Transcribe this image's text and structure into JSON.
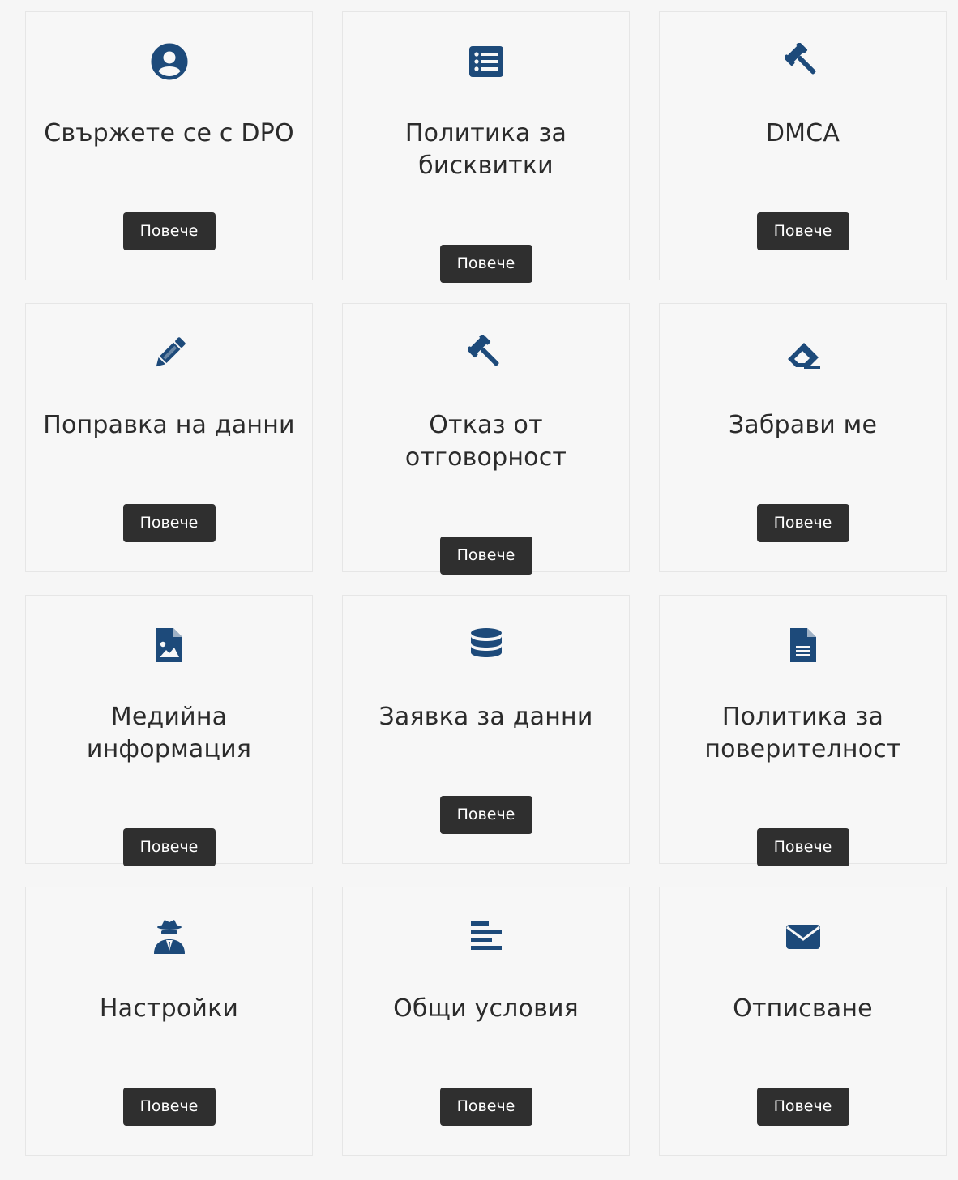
{
  "accent_color": "#1d4a7a",
  "button_color": "#2f2f2f",
  "cards": [
    {
      "title": "Свържете се с DPO",
      "button": "Повече",
      "icon": "user-circle-icon"
    },
    {
      "title": "Политика за бисквитки",
      "button": "Повече",
      "icon": "list-alt-icon"
    },
    {
      "title": "DMCA",
      "button": "Повече",
      "icon": "gavel-icon"
    },
    {
      "title": "Поправка на данни",
      "button": "Повече",
      "icon": "pencil-icon"
    },
    {
      "title": "Отказ от отговорност",
      "button": "Повече",
      "icon": "gavel-icon"
    },
    {
      "title": "Забрави ме",
      "button": "Повече",
      "icon": "eraser-icon"
    },
    {
      "title": "Медийна информация",
      "button": "Повече",
      "icon": "file-image-icon"
    },
    {
      "title": "Заявка за данни",
      "button": "Повече",
      "icon": "database-icon"
    },
    {
      "title": "Политика за поверителност",
      "button": "Повече",
      "icon": "file-text-icon"
    },
    {
      "title": "Настройки",
      "button": "Повече",
      "icon": "user-secret-icon"
    },
    {
      "title": "Общи условия",
      "button": "Повече",
      "icon": "align-left-icon"
    },
    {
      "title": "Отписване",
      "button": "Повече",
      "icon": "envelope-icon"
    }
  ]
}
